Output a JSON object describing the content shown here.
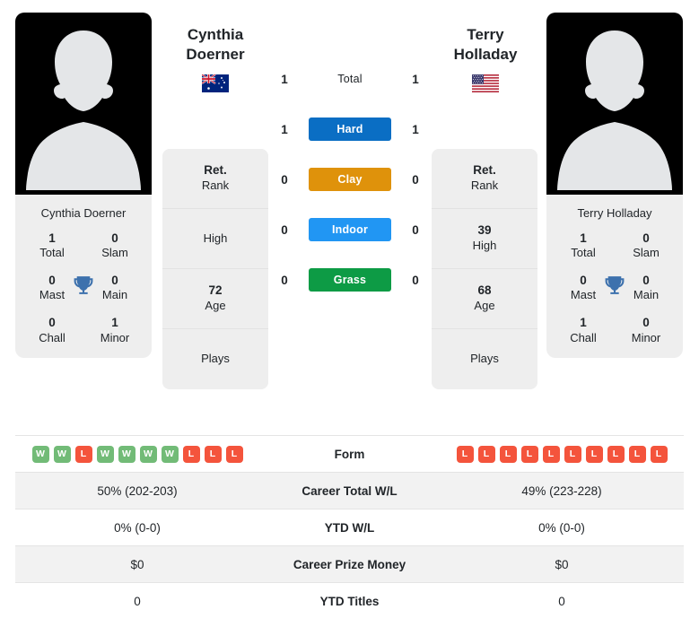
{
  "players": {
    "left": {
      "first_name": "Cynthia",
      "last_name": "Doerner",
      "full_name": "Cynthia Doerner",
      "country_flag": "australia-flag",
      "avatar": "player-silhouette",
      "titles": {
        "total": "1",
        "total_label": "Total",
        "slam": "0",
        "slam_label": "Slam",
        "mast": "0",
        "mast_label": "Mast",
        "main": "0",
        "main_label": "Main",
        "chall": "0",
        "chall_label": "Chall",
        "minor": "1",
        "minor_label": "Minor"
      },
      "rank_rows": [
        {
          "value": "Ret.",
          "label": "Rank"
        },
        {
          "value": "",
          "label": "High"
        },
        {
          "value": "72",
          "label": "Age"
        },
        {
          "value": "",
          "label": "Plays"
        }
      ],
      "surface_values": [
        "1",
        "1",
        "0",
        "0",
        "0"
      ],
      "form": [
        "W",
        "W",
        "L",
        "W",
        "W",
        "W",
        "W",
        "L",
        "L",
        "L"
      ],
      "career_total_wl": "50% (202-203)",
      "ytd_wl": "0% (0-0)",
      "career_prize_money": "$0",
      "ytd_titles": "0"
    },
    "right": {
      "first_name": "Terry",
      "last_name": "Holladay",
      "full_name": "Terry Holladay",
      "country_flag": "usa-flag",
      "avatar": "player-silhouette",
      "titles": {
        "total": "1",
        "total_label": "Total",
        "slam": "0",
        "slam_label": "Slam",
        "mast": "0",
        "mast_label": "Mast",
        "main": "0",
        "main_label": "Main",
        "chall": "1",
        "chall_label": "Chall",
        "minor": "0",
        "minor_label": "Minor"
      },
      "rank_rows": [
        {
          "value": "Ret.",
          "label": "Rank"
        },
        {
          "value": "39",
          "label": "High"
        },
        {
          "value": "68",
          "label": "Age"
        },
        {
          "value": "",
          "label": "Plays"
        }
      ],
      "surface_values": [
        "1",
        "1",
        "0",
        "0",
        "0"
      ],
      "form": [
        "L",
        "L",
        "L",
        "L",
        "L",
        "L",
        "L",
        "L",
        "L",
        "L"
      ],
      "career_total_wl": "49% (223-228)",
      "ytd_wl": "0% (0-0)",
      "career_prize_money": "$0",
      "ytd_titles": "0"
    }
  },
  "surfaces": [
    {
      "label": "Total",
      "color": "transparent",
      "plain": true
    },
    {
      "label": "Hard",
      "color": "#0a6ec4"
    },
    {
      "label": "Clay",
      "color": "#df920b"
    },
    {
      "label": "Indoor",
      "color": "#2196f3"
    },
    {
      "label": "Grass",
      "color": "#0d9b45"
    }
  ],
  "stats_rows": [
    {
      "label": "Form"
    },
    {
      "label": "Career Total W/L"
    },
    {
      "label": "YTD W/L"
    },
    {
      "label": "Career Prize Money"
    },
    {
      "label": "YTD Titles"
    }
  ],
  "colors": {
    "win_badge": "#72bb77",
    "loss_badge": "#f4543c",
    "card_bg": "#eeeeee",
    "photo_bg": "#000000",
    "row_alt_bg": "#f2f2f2"
  },
  "icons": {
    "trophy": "trophy-icon"
  }
}
